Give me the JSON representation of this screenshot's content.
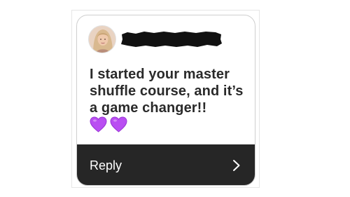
{
  "message": {
    "text": "I started your master shuffle course, and it’s a game changer!!",
    "emoji": [
      "purple-heart",
      "purple-heart"
    ],
    "emoji_color": "#b94ef2"
  },
  "reply": {
    "label": "Reply",
    "bar_color": "#262626"
  },
  "sender": {
    "avatar_icon": "profile-photo",
    "username_redacted": true
  }
}
